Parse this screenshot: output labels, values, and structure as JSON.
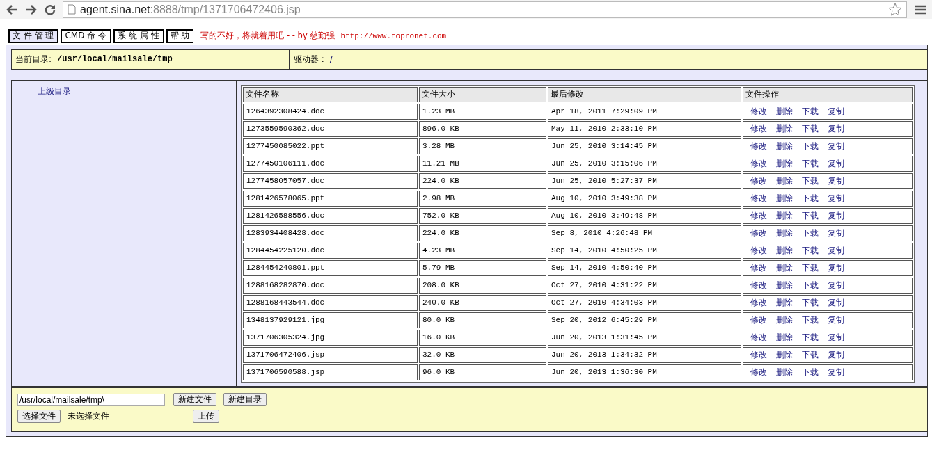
{
  "browser": {
    "url_host": "agent.sina.net",
    "url_rest": ":8888/tmp/1371706472406.jsp"
  },
  "menu": [
    {
      "label": "文 件 管 理",
      "selected": true
    },
    {
      "label": "CMD 命 令",
      "selected": false
    },
    {
      "label": "系 统 属 性",
      "selected": false
    },
    {
      "label": "帮 助",
      "selected": false
    }
  ],
  "tagline": "写的不好，将就着用吧 - - by 慈勤强",
  "tagline_url": "http://www.topronet.com",
  "current_dir": {
    "label": "当前目录:",
    "value": "/usr/local/mailsale/tmp"
  },
  "drive": {
    "label": "驱动器 :",
    "value": "/"
  },
  "parent_link": "上级目录",
  "table": {
    "columns": [
      "文件名称",
      "文件大小",
      "最后修改",
      "文件操作"
    ],
    "rows": [
      {
        "name": "1264392308424.doc",
        "size": "1.23 MB",
        "modified": "Apr 18, 2011 7:29:09 PM",
        "actions": [
          "修改",
          "删除",
          "下载",
          "复制"
        ]
      },
      {
        "name": "1273559590362.doc",
        "size": "896.0 KB",
        "modified": "May 11, 2010 2:33:10 PM",
        "actions": [
          "修改",
          "删除",
          "下载",
          "复制"
        ]
      },
      {
        "name": "1277450085022.ppt",
        "size": "3.28 MB",
        "modified": "Jun 25, 2010 3:14:45 PM",
        "actions": [
          "修改",
          "删除",
          "下载",
          "复制"
        ]
      },
      {
        "name": "1277450106111.doc",
        "size": "11.21 MB",
        "modified": "Jun 25, 2010 3:15:06 PM",
        "actions": [
          "修改",
          "删除",
          "下载",
          "复制"
        ]
      },
      {
        "name": "1277458057057.doc",
        "size": "224.0 KB",
        "modified": "Jun 25, 2010 5:27:37 PM",
        "actions": [
          "修改",
          "删除",
          "下载",
          "复制"
        ]
      },
      {
        "name": "1281426578065.ppt",
        "size": "2.98 MB",
        "modified": "Aug 10, 2010 3:49:38 PM",
        "actions": [
          "修改",
          "删除",
          "下载",
          "复制"
        ]
      },
      {
        "name": "1281426588556.doc",
        "size": "752.0 KB",
        "modified": "Aug 10, 2010 3:49:48 PM",
        "actions": [
          "修改",
          "删除",
          "下载",
          "复制"
        ]
      },
      {
        "name": "1283934408428.doc",
        "size": "224.0 KB",
        "modified": "Sep 8, 2010 4:26:48 PM",
        "actions": [
          "修改",
          "删除",
          "下载",
          "复制"
        ]
      },
      {
        "name": "1284454225120.doc",
        "size": "4.23 MB",
        "modified": "Sep 14, 2010 4:50:25 PM",
        "actions": [
          "修改",
          "删除",
          "下载",
          "复制"
        ]
      },
      {
        "name": "1284454240801.ppt",
        "size": "5.79 MB",
        "modified": "Sep 14, 2010 4:50:40 PM",
        "actions": [
          "修改",
          "删除",
          "下载",
          "复制"
        ]
      },
      {
        "name": "1288168282870.doc",
        "size": "208.0 KB",
        "modified": "Oct 27, 2010 4:31:22 PM",
        "actions": [
          "修改",
          "删除",
          "下载",
          "复制"
        ]
      },
      {
        "name": "1288168443544.doc",
        "size": "240.0 KB",
        "modified": "Oct 27, 2010 4:34:03 PM",
        "actions": [
          "修改",
          "删除",
          "下载",
          "复制"
        ]
      },
      {
        "name": "1348137929121.jpg",
        "size": "80.0 KB",
        "modified": "Sep 20, 2012 6:45:29 PM",
        "actions": [
          "修改",
          "删除",
          "下载",
          "复制"
        ]
      },
      {
        "name": "1371706305324.jpg",
        "size": "16.0 KB",
        "modified": "Jun 20, 2013 1:31:45 PM",
        "actions": [
          "修改",
          "删除",
          "下载",
          "复制"
        ]
      },
      {
        "name": "1371706472406.jsp",
        "size": "32.0 KB",
        "modified": "Jun 20, 2013 1:34:32 PM",
        "actions": [
          "修改",
          "删除",
          "下载",
          "复制"
        ]
      },
      {
        "name": "1371706590588.jsp",
        "size": "96.0 KB",
        "modified": "Jun 20, 2013 1:36:30 PM",
        "actions": [
          "修改",
          "删除",
          "下载",
          "复制"
        ]
      }
    ]
  },
  "path_field": {
    "value": "/usr/local/mailsale/tmp\\"
  },
  "buttons": [
    "新建文件",
    "新建目录"
  ],
  "file_picker": {
    "button": "选择文件",
    "status": "未选择文件"
  },
  "upload_button": "上传"
}
